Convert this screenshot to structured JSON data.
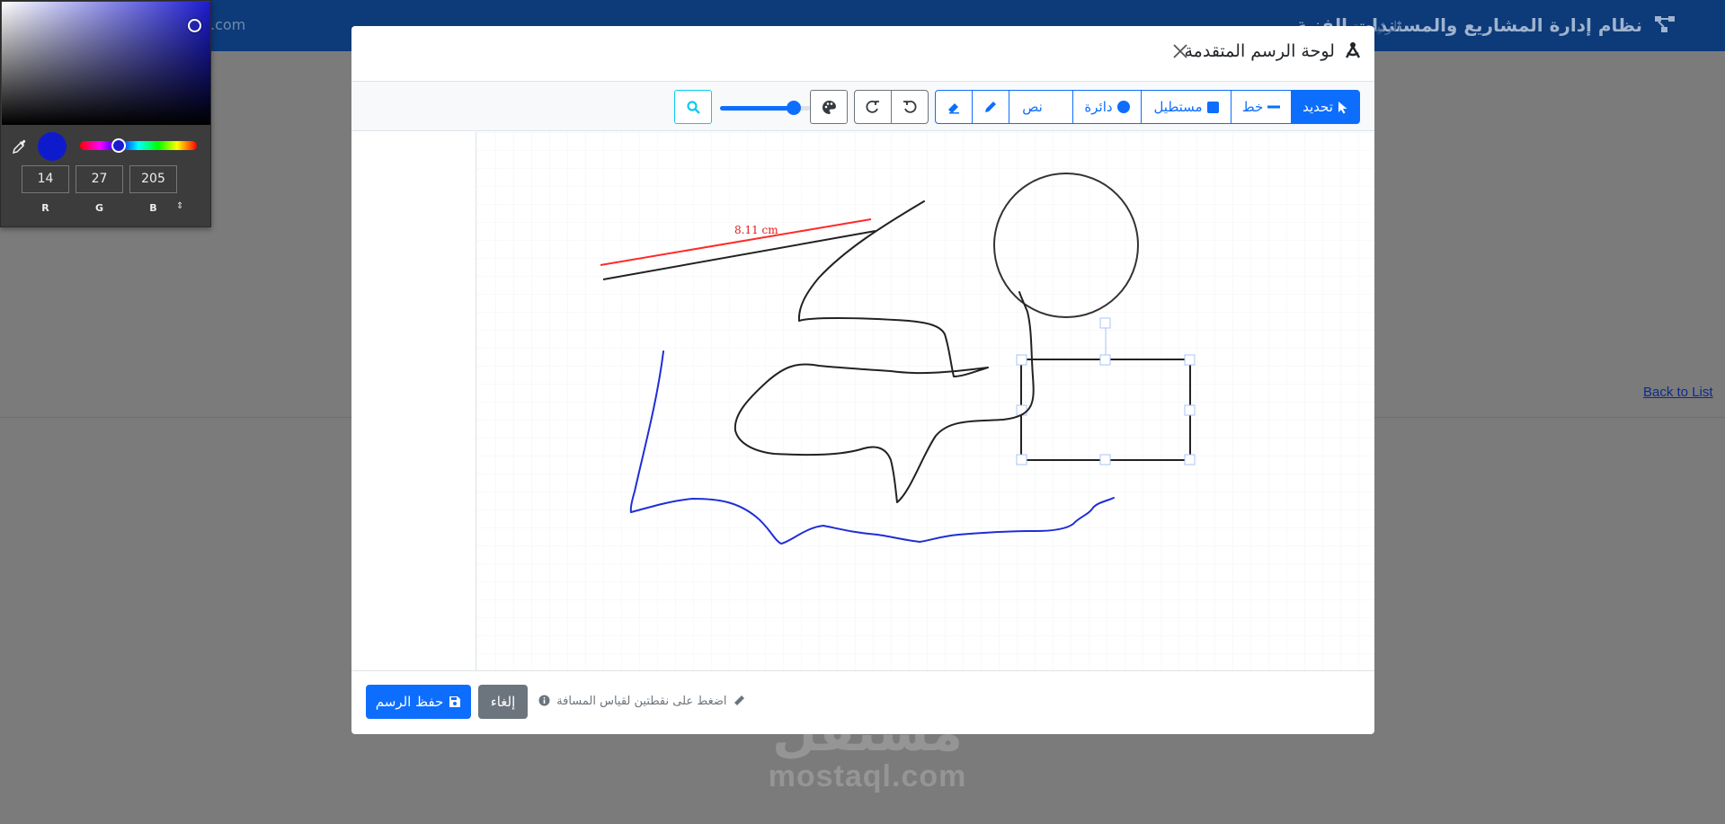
{
  "background": {
    "brand_title": "نظام إدارة المشاريع والمستندات الفنية",
    "home_link": "الرئيسية",
    "topbar_left": ".com",
    "back_link": "Back to List",
    "watermark_ar": "مستقل",
    "watermark_en": "mostaql.com"
  },
  "modal": {
    "title": "لوحة الرسم المتقدمة",
    "close_icon": "close-x-icon",
    "toolbar": {
      "select_label": "تحديد",
      "line_label": "خط",
      "rect_label": "مستطيل",
      "circle_label": "دائرة",
      "text_label": "نص",
      "pen_icon": "pencil-icon",
      "eraser_icon": "eraser-icon",
      "undo_icon": "undo-icon",
      "redo_icon": "redo-icon",
      "color_icon": "palette-icon",
      "zoom_icon": "search-icon",
      "brush_size_fraction": 0.82
    },
    "canvas": {
      "measurement_label": "8.11 cm",
      "stroke_colors": {
        "black": "#222222",
        "measure": "#ff2a2a",
        "blue": "#1f2ed6",
        "selection": "#a9c4f5"
      }
    },
    "footer": {
      "save_label": "حفظ الرسم",
      "cancel_label": "إلغاء",
      "hint": "اضغط على نقطتين لقياس المسافة"
    }
  },
  "color_picker": {
    "hue_color": "#1b1bd0",
    "selected_color": "#0e1bcd",
    "r": "14",
    "g": "27",
    "b": "205",
    "r_label": "R",
    "g_label": "G",
    "b_label": "B",
    "mode_toggle": "⇕",
    "hue_position_fraction": 0.33
  },
  "colors": {
    "primary": "#0d6efd",
    "topbar": "#0d3a78",
    "overlay": "#7b7b7b"
  }
}
